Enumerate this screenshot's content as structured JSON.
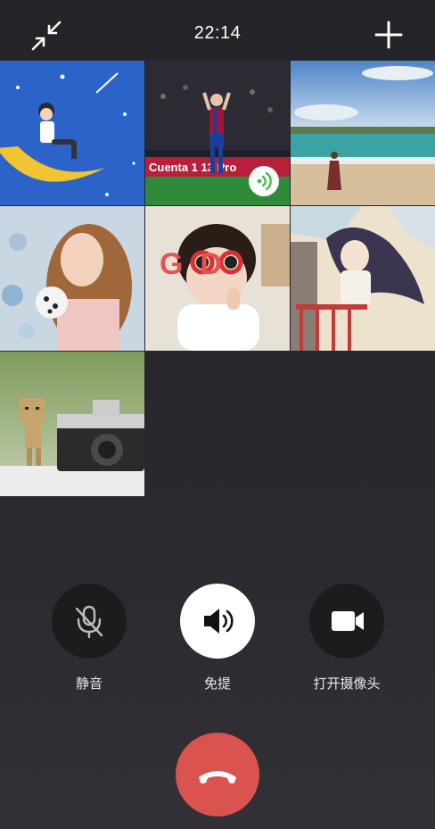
{
  "status_bar": {
    "time": "22:14"
  },
  "header": {
    "minimize_icon": "collapse-arrows-icon",
    "add_icon": "plus-icon"
  },
  "participants": [
    {
      "avatar": "boy-on-moon-illustration"
    },
    {
      "avatar": "soccer-player-celebrating",
      "speaking": true,
      "speaking_icon": "sound-waves-icon",
      "banner_text": "Cuenta 1 13 Pro"
    },
    {
      "avatar": "beach-woman-photo"
    },
    {
      "avatar": "girl-with-curly-hair-photo"
    },
    {
      "avatar": "baby-red-sunglasses-good",
      "overlay_text": "G  D"
    },
    {
      "avatar": "anime-girl-balcony-illustration"
    },
    {
      "avatar": "cardboard-box-robot-camera"
    }
  ],
  "controls": {
    "mute": {
      "label": "静音",
      "icon": "microphone-off-icon"
    },
    "speaker": {
      "label": "免提",
      "icon": "speaker-icon",
      "active": true
    },
    "camera": {
      "label": "打开摄像头",
      "icon": "video-camera-icon"
    }
  },
  "hangup": {
    "icon": "phone-hangup-icon"
  },
  "colors": {
    "hangup": "#d9534f",
    "speaking": "#3fbf4a",
    "background": "#262529"
  }
}
